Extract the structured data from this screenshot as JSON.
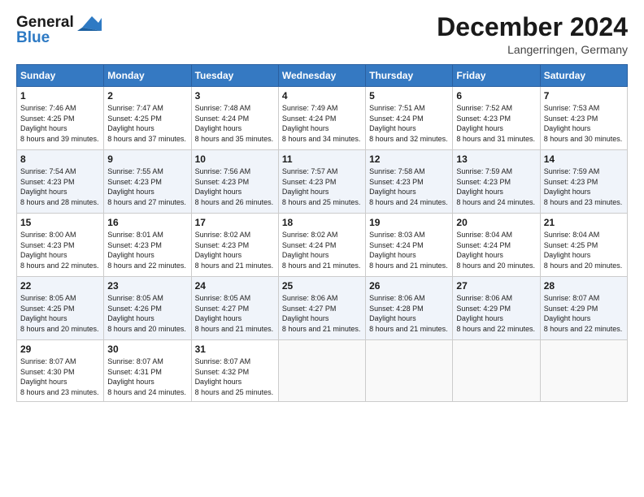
{
  "header": {
    "logo_line1": "General",
    "logo_line2": "Blue",
    "month": "December 2024",
    "location": "Langerringen, Germany"
  },
  "weekdays": [
    "Sunday",
    "Monday",
    "Tuesday",
    "Wednesday",
    "Thursday",
    "Friday",
    "Saturday"
  ],
  "weeks": [
    [
      {
        "day": "1",
        "sunrise": "7:46 AM",
        "sunset": "4:25 PM",
        "daylight": "8 hours and 39 minutes."
      },
      {
        "day": "2",
        "sunrise": "7:47 AM",
        "sunset": "4:25 PM",
        "daylight": "8 hours and 37 minutes."
      },
      {
        "day": "3",
        "sunrise": "7:48 AM",
        "sunset": "4:24 PM",
        "daylight": "8 hours and 35 minutes."
      },
      {
        "day": "4",
        "sunrise": "7:49 AM",
        "sunset": "4:24 PM",
        "daylight": "8 hours and 34 minutes."
      },
      {
        "day": "5",
        "sunrise": "7:51 AM",
        "sunset": "4:24 PM",
        "daylight": "8 hours and 32 minutes."
      },
      {
        "day": "6",
        "sunrise": "7:52 AM",
        "sunset": "4:23 PM",
        "daylight": "8 hours and 31 minutes."
      },
      {
        "day": "7",
        "sunrise": "7:53 AM",
        "sunset": "4:23 PM",
        "daylight": "8 hours and 30 minutes."
      }
    ],
    [
      {
        "day": "8",
        "sunrise": "7:54 AM",
        "sunset": "4:23 PM",
        "daylight": "8 hours and 28 minutes."
      },
      {
        "day": "9",
        "sunrise": "7:55 AM",
        "sunset": "4:23 PM",
        "daylight": "8 hours and 27 minutes."
      },
      {
        "day": "10",
        "sunrise": "7:56 AM",
        "sunset": "4:23 PM",
        "daylight": "8 hours and 26 minutes."
      },
      {
        "day": "11",
        "sunrise": "7:57 AM",
        "sunset": "4:23 PM",
        "daylight": "8 hours and 25 minutes."
      },
      {
        "day": "12",
        "sunrise": "7:58 AM",
        "sunset": "4:23 PM",
        "daylight": "8 hours and 24 minutes."
      },
      {
        "day": "13",
        "sunrise": "7:59 AM",
        "sunset": "4:23 PM",
        "daylight": "8 hours and 24 minutes."
      },
      {
        "day": "14",
        "sunrise": "7:59 AM",
        "sunset": "4:23 PM",
        "daylight": "8 hours and 23 minutes."
      }
    ],
    [
      {
        "day": "15",
        "sunrise": "8:00 AM",
        "sunset": "4:23 PM",
        "daylight": "8 hours and 22 minutes."
      },
      {
        "day": "16",
        "sunrise": "8:01 AM",
        "sunset": "4:23 PM",
        "daylight": "8 hours and 22 minutes."
      },
      {
        "day": "17",
        "sunrise": "8:02 AM",
        "sunset": "4:23 PM",
        "daylight": "8 hours and 21 minutes."
      },
      {
        "day": "18",
        "sunrise": "8:02 AM",
        "sunset": "4:24 PM",
        "daylight": "8 hours and 21 minutes."
      },
      {
        "day": "19",
        "sunrise": "8:03 AM",
        "sunset": "4:24 PM",
        "daylight": "8 hours and 21 minutes."
      },
      {
        "day": "20",
        "sunrise": "8:04 AM",
        "sunset": "4:24 PM",
        "daylight": "8 hours and 20 minutes."
      },
      {
        "day": "21",
        "sunrise": "8:04 AM",
        "sunset": "4:25 PM",
        "daylight": "8 hours and 20 minutes."
      }
    ],
    [
      {
        "day": "22",
        "sunrise": "8:05 AM",
        "sunset": "4:25 PM",
        "daylight": "8 hours and 20 minutes."
      },
      {
        "day": "23",
        "sunrise": "8:05 AM",
        "sunset": "4:26 PM",
        "daylight": "8 hours and 20 minutes."
      },
      {
        "day": "24",
        "sunrise": "8:05 AM",
        "sunset": "4:27 PM",
        "daylight": "8 hours and 21 minutes."
      },
      {
        "day": "25",
        "sunrise": "8:06 AM",
        "sunset": "4:27 PM",
        "daylight": "8 hours and 21 minutes."
      },
      {
        "day": "26",
        "sunrise": "8:06 AM",
        "sunset": "4:28 PM",
        "daylight": "8 hours and 21 minutes."
      },
      {
        "day": "27",
        "sunrise": "8:06 AM",
        "sunset": "4:29 PM",
        "daylight": "8 hours and 22 minutes."
      },
      {
        "day": "28",
        "sunrise": "8:07 AM",
        "sunset": "4:29 PM",
        "daylight": "8 hours and 22 minutes."
      }
    ],
    [
      {
        "day": "29",
        "sunrise": "8:07 AM",
        "sunset": "4:30 PM",
        "daylight": "8 hours and 23 minutes."
      },
      {
        "day": "30",
        "sunrise": "8:07 AM",
        "sunset": "4:31 PM",
        "daylight": "8 hours and 24 minutes."
      },
      {
        "day": "31",
        "sunrise": "8:07 AM",
        "sunset": "4:32 PM",
        "daylight": "8 hours and 25 minutes."
      },
      null,
      null,
      null,
      null
    ]
  ]
}
